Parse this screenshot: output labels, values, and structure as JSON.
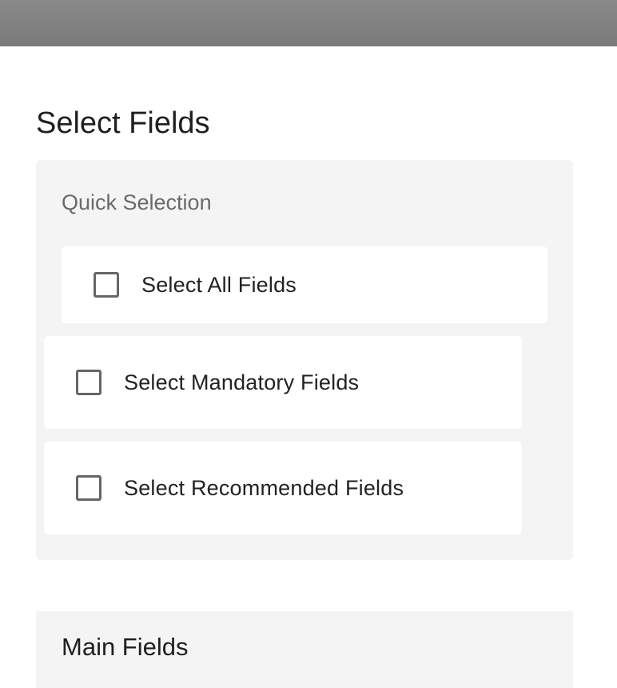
{
  "page": {
    "title": "Select Fields"
  },
  "quick_selection": {
    "label": "Quick Selection",
    "options": [
      {
        "label": "Select All Fields",
        "checked": false
      },
      {
        "label": "Select Mandatory Fields",
        "checked": false
      },
      {
        "label": "Select Recommended Fields",
        "checked": false
      }
    ]
  },
  "main_fields": {
    "title": "Main Fields"
  },
  "colors": {
    "topbar": "#7f7f7f",
    "panel_bg": "#f4f4f4",
    "card_bg": "#ffffff",
    "checkbox_border": "#666666",
    "text": "#222222",
    "muted_text": "#6a6a6a"
  }
}
